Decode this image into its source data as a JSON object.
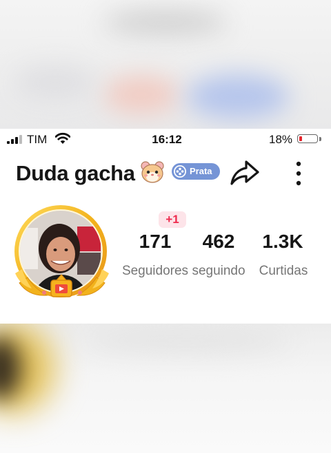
{
  "status_bar": {
    "carrier": "TIM",
    "time": "16:12",
    "battery_percent": "18%",
    "battery_level": 0.18,
    "signal_bars_active": 3,
    "signal_bars_total": 4
  },
  "profile": {
    "username": "Duda gacha",
    "name_icon": "hamster-icon",
    "badge_label": "Prata",
    "badge_icon": "film-reel-icon",
    "avatar_frame": "gold-wreath-frame",
    "new_follower_badge": "+1"
  },
  "stats": [
    {
      "value": "171",
      "label": "Seguidores"
    },
    {
      "value": "462",
      "label": "seguindo"
    },
    {
      "value": "1.3K",
      "label": "Curtidas"
    }
  ],
  "colors": {
    "badge_bg": "#7594d6",
    "notification_red": "#ee2a4d",
    "notification_bg": "#fde4e9",
    "frame_gold": "#f2b21c",
    "battery_low": "#e5262d"
  }
}
